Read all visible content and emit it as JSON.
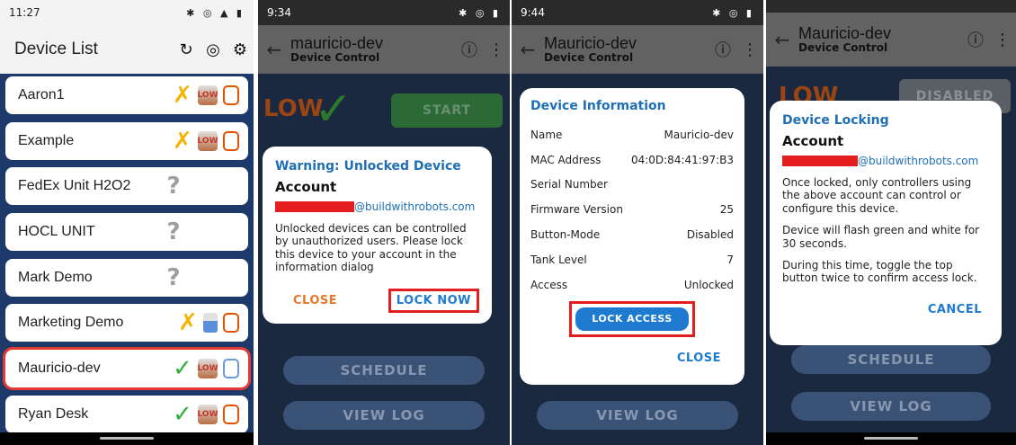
{
  "panel1": {
    "status": {
      "time": "11:27",
      "icons": "✱ ◎ ▲ ▮"
    },
    "title": "Device List",
    "devices": [
      {
        "name": "Aaron1",
        "status": "x",
        "tank": "low",
        "lock": "orange"
      },
      {
        "name": "Example",
        "status": "x",
        "tank": "low",
        "lock": "orange"
      },
      {
        "name": "FedEx Unit H2O2",
        "status": "q",
        "tank": "",
        "lock": ""
      },
      {
        "name": "HOCL UNIT",
        "status": "q",
        "tank": "",
        "lock": ""
      },
      {
        "name": "Mark Demo",
        "status": "q",
        "tank": "",
        "lock": ""
      },
      {
        "name": "Marketing Demo",
        "status": "x",
        "tank": "tank",
        "lock": "orange"
      },
      {
        "name": "Mauricio-dev",
        "status": "check",
        "tank": "low",
        "lock": "blue"
      },
      {
        "name": "Ryan Desk",
        "status": "check",
        "tank": "low",
        "lock": "orange"
      }
    ],
    "low_label": "LOW"
  },
  "panel2": {
    "status": {
      "time": "9:34"
    },
    "title": "mauricio-dev",
    "subtitle": "Device Control",
    "bg": {
      "low": "LOW",
      "start": "START",
      "schedule": "SCHEDULE",
      "view_log": "VIEW LOG"
    },
    "dialog": {
      "title": "Warning: Unlocked Device",
      "heading": "Account",
      "email": "@buildwithrobots.com",
      "body": "Unlocked devices can be controlled by unauthorized users. Please lock this device to your account in the information dialog",
      "close": "CLOSE",
      "lock_now": "LOCK NOW"
    }
  },
  "panel3": {
    "status": {
      "time": "9:44"
    },
    "title": "Mauricio-dev",
    "subtitle": "Device Control",
    "bg": {
      "view_log": "VIEW LOG"
    },
    "dialog": {
      "title": "Device Information",
      "rows": [
        {
          "label": "Name",
          "value": "Mauricio-dev"
        },
        {
          "label": "MAC Address",
          "value": "04:0D:84:41:97:B3"
        },
        {
          "label": "Serial Number",
          "value": ""
        },
        {
          "label": "Firmware Version",
          "value": "25"
        },
        {
          "label": "Button-Mode",
          "value": "Disabled"
        },
        {
          "label": "Tank Level",
          "value": "7"
        },
        {
          "label": "Access",
          "value": "Unlocked"
        }
      ],
      "lock_access": "LOCK ACCESS",
      "close": "CLOSE"
    }
  },
  "panel4": {
    "title": "Mauricio-dev",
    "subtitle": "Device Control",
    "bg": {
      "low": "LOW",
      "disabled": "DISABLED",
      "schedule": "SCHEDULE",
      "view_log": "VIEW LOG"
    },
    "dialog": {
      "title": "Device Locking",
      "heading": "Account",
      "email": "@buildwithrobots.com",
      "p1": "Once locked, only controllers using the above account can control or configure this device.",
      "p2": "Device will flash green and white for 30 seconds.",
      "p3": "During this time, toggle the top button twice to confirm access lock.",
      "cancel": "CANCEL"
    }
  }
}
